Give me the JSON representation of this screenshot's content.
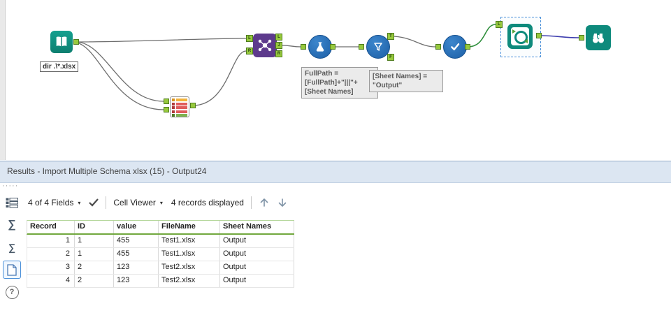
{
  "canvas": {
    "input_label": "dir .\\*.xlsx",
    "formula_annotation": "FullPath =\n[FullPath]+\"|||\"+\n[Sheet Names]",
    "filter_annotation": "[Sheet Names] =\n\"Output\"",
    "anchors": {
      "join_in_l": "L",
      "join_in_r": "R",
      "join_out_l": "L",
      "join_out_j": "J",
      "join_out_r": "R",
      "filter_out_t": "T",
      "filter_out_f": "F",
      "macro_in_l": "L"
    },
    "colors": {
      "tool_teal": "#0e8a7c",
      "tool_blue": "#2a6cb3",
      "tool_purple": "#5d3a8c",
      "anchor_green": "#97c93d",
      "wire_gray": "#6e6e6e",
      "wire_green": "#2f8f3c",
      "wire_navy": "#3d3dae",
      "selection_blue": "#4a90d9"
    }
  },
  "results": {
    "title": "Results - Import Multiple Schema xlsx (15) - Output24",
    "toolbar": {
      "fields": "4 of 4 Fields",
      "cell_viewer": "Cell Viewer",
      "records": "4 records displayed"
    },
    "table": {
      "columns": [
        "Record",
        "ID",
        "value",
        "FileName",
        "Sheet Names"
      ],
      "rows": [
        [
          "1",
          "1",
          "455",
          "Test1.xlsx",
          "Output"
        ],
        [
          "2",
          "1",
          "455",
          "Test1.xlsx",
          "Output"
        ],
        [
          "3",
          "2",
          "123",
          "Test2.xlsx",
          "Output"
        ],
        [
          "4",
          "2",
          "123",
          "Test2.xlsx",
          "Output"
        ]
      ]
    }
  },
  "icons": {
    "caret_down": "▾",
    "sigma": "∑",
    "question": "?",
    "grip": "·····"
  }
}
